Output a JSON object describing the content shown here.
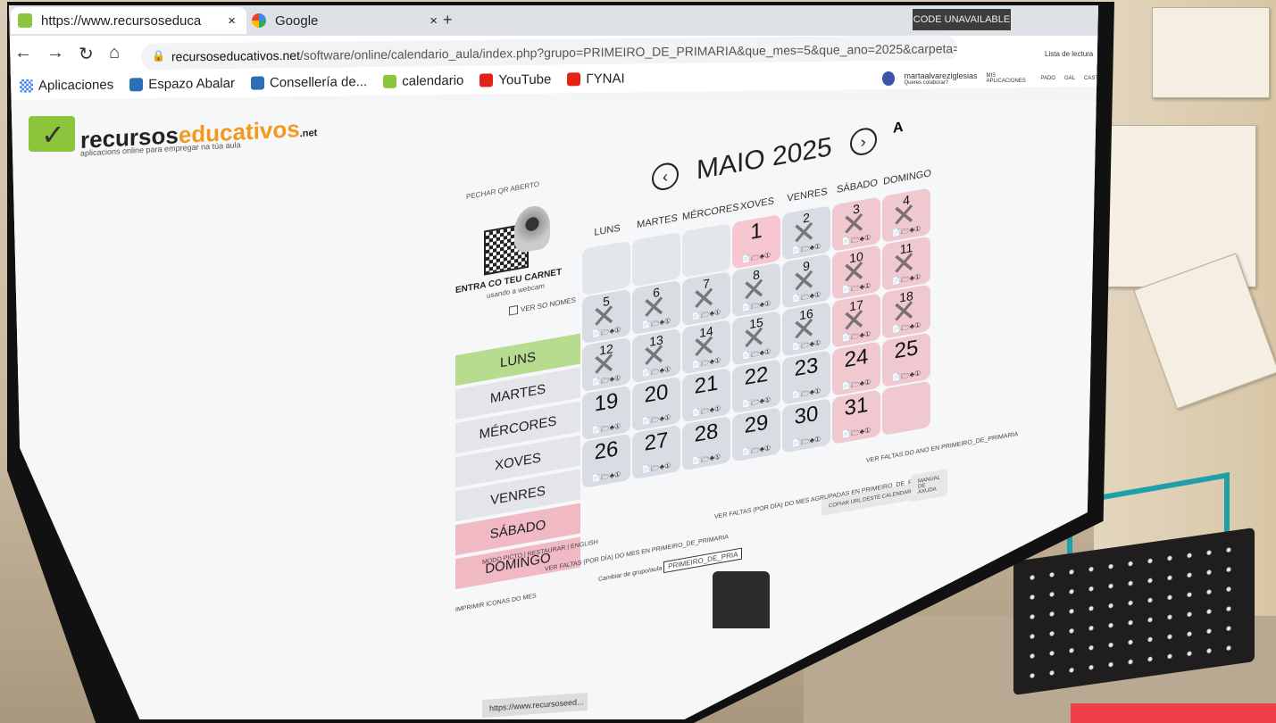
{
  "browser": {
    "tabs": [
      {
        "label": "https://www.recursoseduca",
        "close": "×"
      },
      {
        "label": "Google",
        "close": "×"
      }
    ],
    "new_tab": "+",
    "code_unavailable": "CODE UNAVAILABLE",
    "url_domain": "recursoseducativos.net",
    "url_path": "/software/online/calendario_aula/index.php?grupo=PRIMEIRO_DE_PRIMARIA&que_mes=5&que_ano=2025&carpeta=martaalvareziglesias&idioma_cal=#",
    "bookmarks": [
      "Aplicaciones",
      "Espazo Abalar",
      "Consellería de...",
      "calendario",
      "YouTube",
      "ΓΥΝΑΙ"
    ],
    "reading_list": "Lista de lectura"
  },
  "site": {
    "logo_main": "recursos",
    "logo_accent": "educativos",
    "logo_net": ".net",
    "logo_sub": "aplicacions online para empregar na túa aula",
    "user": "martaalvareziglesias",
    "user_sub": "Queres colaborar?",
    "menu": [
      "MIS APLICACIONES",
      "PADO",
      "GAL",
      "CAST"
    ]
  },
  "calendar": {
    "month_title": "MAIO 2025",
    "prev": "‹",
    "next": "›",
    "font_tool": "A",
    "qr_close": "PECHAR QR ABERTO",
    "carnet": "ENTRA CO TEU CARNET",
    "webcam": "usando a webcam",
    "ver_nomes": "VER SO NOMES",
    "day_list": [
      "LUNS",
      "MARTES",
      "MÉRCORES",
      "XOVES",
      "VENRES",
      "SÁBADO",
      "DOMINGO"
    ],
    "headers": [
      "LUNS",
      "MARTES",
      "MÉRCORES",
      "XOVES",
      "VENRES",
      "SÁBADO",
      "DOMINGO"
    ],
    "weeks": [
      [
        "",
        "",
        "",
        "1",
        "2",
        "3",
        "4"
      ],
      [
        "5",
        "6",
        "7",
        "8",
        "9",
        "10",
        "11"
      ],
      [
        "12",
        "13",
        "14",
        "15",
        "16",
        "17",
        "18"
      ],
      [
        "19",
        "20",
        "21",
        "22",
        "23",
        "24",
        "25"
      ],
      [
        "26",
        "27",
        "28",
        "29",
        "30",
        "31",
        ""
      ]
    ],
    "cell_icons": "📄🗁♣①"
  },
  "footer": {
    "modo": "MODO PICTO | RESTAURAR | ENGLISH",
    "imprimir": "IMPRIMIR ICONAS DO MES",
    "faltas_dia": "VER FALTAS (POR DÍA) DO MES EN PRIMEIRO_DE_PRIMARIA",
    "faltas_agrupadas": "VER FALTAS (POR DÍA) DO MES AGRUPADAS EN PRIMEIRO_DE_PRIMARIA",
    "faltas_curso": "VER FALTAS DO ANO EN PRIMEIRO_DE_PRIMARIA",
    "cambiar": "Cambiar de grupo/aula",
    "select": "PRIMEIRO_DE_PRIA",
    "copiar": "COPIAR URL DESTE CALENDARIO",
    "manual": "MANUAL DE AXUDA"
  },
  "taskbar": {
    "url": "https://www.recursoseed..."
  }
}
